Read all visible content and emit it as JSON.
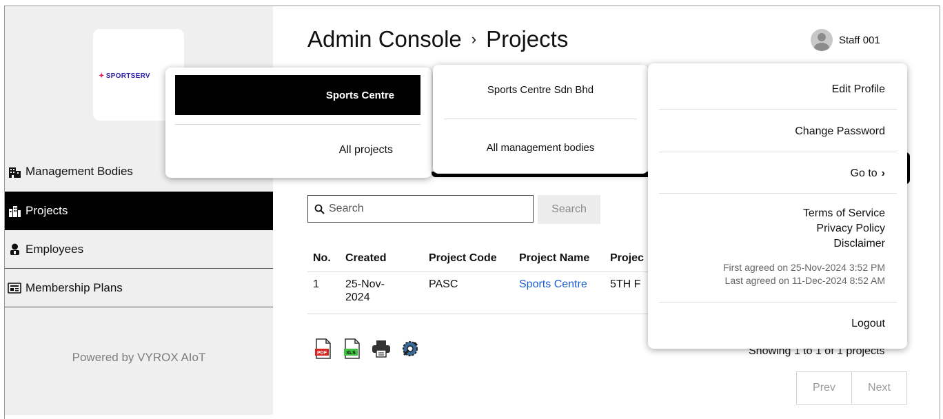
{
  "brand": {
    "logo_text": "SPORTSERV",
    "colors": {
      "logo": "#2a1fae",
      "accent": "#e0245e",
      "link": "#1a5fd1",
      "active_nav": "#000000"
    }
  },
  "sidebar": {
    "items": [
      {
        "label": "Management Bodies",
        "icon": "building-icon"
      },
      {
        "label": "Projects",
        "icon": "city-icon",
        "active": true
      },
      {
        "label": "Employees",
        "icon": "person-icon"
      },
      {
        "label": "Membership Plans",
        "icon": "card-icon"
      }
    ],
    "powered_by": "Powered by VYROX AIoT"
  },
  "header": {
    "breadcrumb_root": "Admin Console",
    "separator": "›",
    "page_title": "Projects",
    "user_name": "Staff 001"
  },
  "search": {
    "placeholder": "Search",
    "button_label": "Search"
  },
  "table": {
    "headers": [
      "No.",
      "Created",
      "Project Code",
      "Project Name",
      "Projec"
    ],
    "rows": [
      {
        "no": "1",
        "created_line1": "25-Nov-",
        "created_line2": "2024",
        "code": "PASC",
        "name": "Sports Centre",
        "extra": "5TH F"
      }
    ]
  },
  "toolbar": {
    "icons": [
      "pdf-icon",
      "xls-icon",
      "printer-icon",
      "settings-icon"
    ],
    "pdf_text": "PDF",
    "xls_text": "XLS"
  },
  "pagination": {
    "showing": "Showing 1 to 1 of 1 projects",
    "prev": "Prev",
    "next": "Next"
  },
  "project_menu": {
    "selected": "Sports Centre",
    "all": "All projects"
  },
  "body_menu": {
    "selected": "Sports Centre Sdn Bhd",
    "all": "All management bodies"
  },
  "user_menu": {
    "edit_profile": "Edit Profile",
    "change_password": "Change Password",
    "go_to": "Go to",
    "terms": "Terms of Service",
    "privacy": "Privacy Policy",
    "disclaimer": "Disclaimer",
    "first_agreed": "First agreed on 25-Nov-2024 3:52 PM",
    "last_agreed": "Last agreed on 11-Dec-2024 8:52 AM",
    "logout": "Logout"
  }
}
